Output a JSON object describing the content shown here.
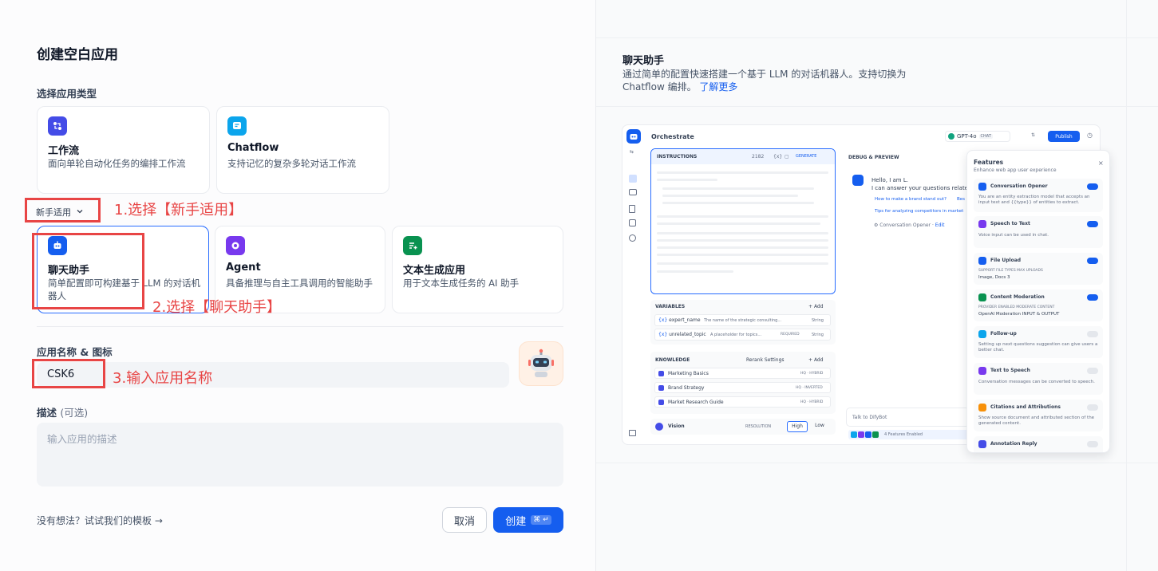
{
  "page_title": "创建空白应用",
  "type_section_label": "选择应用类型",
  "top_cards": [
    {
      "title": "工作流",
      "desc": "面向单轮自动化任务的编排工作流",
      "color": "#444ce7"
    },
    {
      "title": "Chatflow",
      "desc": "支持记忆的复杂多轮对话工作流",
      "color": "#0ba5ec"
    }
  ],
  "dropdown_label": "新手适用",
  "beginner_cards": [
    {
      "title": "聊天助手",
      "desc": "简单配置即可构建基于 LLM 的对话机器人",
      "color": "#155eef"
    },
    {
      "title": "Agent",
      "desc": "具备推理与自主工具调用的智能助手",
      "color": "#7839ee"
    },
    {
      "title": "文本生成应用",
      "desc": "用于文本生成任务的 AI 助手",
      "color": "#099250"
    }
  ],
  "name_section_label": "应用名称 & 图标",
  "app_name_value": "CSK6",
  "desc_section_label": "描述",
  "desc_optional": "(可选)",
  "desc_placeholder": "输入应用的描述",
  "template_link": "没有想法？试试我们的模板 →",
  "cancel_label": "取消",
  "create_label": "创建",
  "create_kbd": "⌘ ↵",
  "annotations": {
    "step1": "1.选择【新手适用】",
    "step2": "2.选择【聊天助手】",
    "step3": "3.输入应用名称"
  },
  "preview": {
    "title": "聊天助手",
    "desc": "通过简单的配置快速搭建一个基于 LLM 的对话机器人。支持切换为 Chatflow 编排。",
    "learn_more": "了解更多",
    "orchestrate": "Orchestrate",
    "model": "GPT-4o",
    "model_tag": "CHAT",
    "publish": "Publish",
    "instructions": "INSTRUCTIONS",
    "instructions_count": "2182",
    "generate": "GENERATE",
    "debug_preview": "DEBUG & PREVIEW",
    "hello": "Hello, I am L.",
    "hello_sub": "I can answer your questions related",
    "q1": "How to make a brand stand out?",
    "q1b": "Bes",
    "q2": "Tips for analyzing competitors in market",
    "opener_footer": "Conversation Opener",
    "opener_edit": "Edit",
    "variables": "VARIABLES",
    "add": "Add",
    "vars": [
      {
        "name": "expert_name",
        "desc": "The name of the strategic consulting...",
        "type": "String",
        "required": ""
      },
      {
        "name": "unrelated_topic",
        "desc": "A placeholder for topics...",
        "type": "String",
        "required": "REQUIRED"
      }
    ],
    "knowledge": "KNOWLEDGE",
    "rerank": "Rerank Settings",
    "kb": [
      {
        "name": "Marketing Basics",
        "tag": "HQ · HYBRID"
      },
      {
        "name": "Brand Strategy",
        "tag": "HQ · INVERTED"
      },
      {
        "name": "Market Research Guide",
        "tag": "HQ · HYBRID"
      }
    ],
    "vision": "Vision",
    "resolution": "RESOLUTION",
    "high": "High",
    "low": "Low",
    "talk_placeholder": "Talk to DifyBot",
    "features_enabled": "4 Features Enabled",
    "features_title": "Features",
    "features_sub": "Enhance web app user experience",
    "features": [
      {
        "name": "Conversation Opener",
        "desc": "You are an entity extraction model that accepts an input text and {{type}} of entities to extract.",
        "on": true,
        "color": "#155eef"
      },
      {
        "name": "Speech to Text",
        "desc": "Voice input can be used in chat.",
        "on": true,
        "color": "#7839ee"
      },
      {
        "name": "File Upload",
        "desc": "SUPPORT FILE TYPES   MAX UPLOADS",
        "desc2": "Image, Docs   3",
        "on": true,
        "color": "#155eef"
      },
      {
        "name": "Content Moderation",
        "desc": "PROVIDER   ENABLED MODERATE CONTENT",
        "desc2": "OpenAI Moderation   INPUT & OUTPUT",
        "on": true,
        "color": "#099250"
      },
      {
        "name": "Follow-up",
        "desc": "Setting up next questions suggestion can give users a better chat.",
        "on": false,
        "color": "#0ba5ec"
      },
      {
        "name": "Text to Speech",
        "desc": "Conversation messages can be converted to speech.",
        "on": false,
        "color": "#7839ee"
      },
      {
        "name": "Citations and Attributions",
        "desc": "Show source document and attributed section of the generated content.",
        "on": false,
        "color": "#f79009"
      },
      {
        "name": "Annotation Reply",
        "desc": "",
        "on": false,
        "color": "#444ce7"
      }
    ]
  }
}
